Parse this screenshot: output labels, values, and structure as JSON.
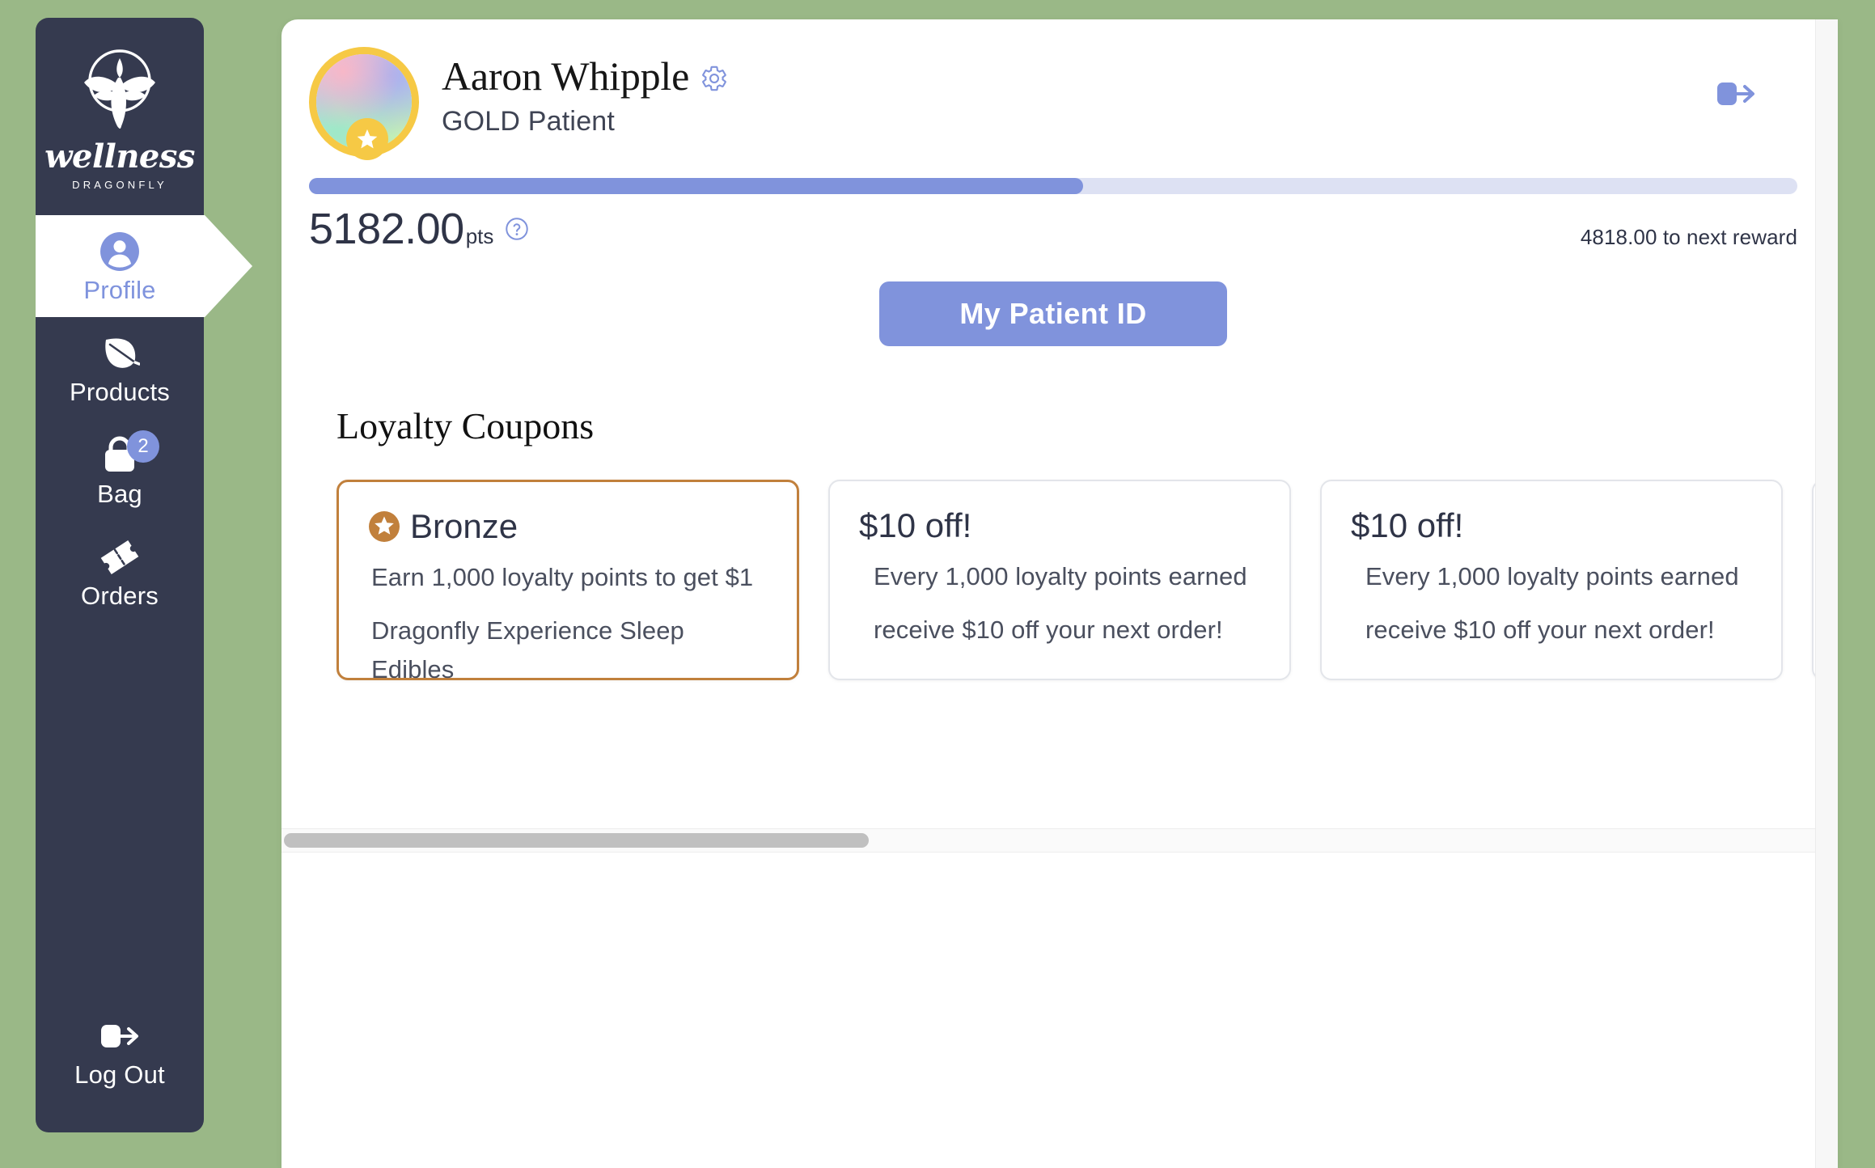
{
  "theme": {
    "background_green": "#9ab887",
    "sidebar_dark": "#353a4f",
    "accent_blue": "#8093dc",
    "gold": "#f6c945",
    "bronze": "#c1803c",
    "panel_white": "#ffffff"
  },
  "sidebar": {
    "brand": {
      "logo_icon": "dragonfly-lotus-icon",
      "name": "wellness",
      "subtitle": "DRAGONFLY"
    },
    "items": [
      {
        "id": "profile",
        "label": "Profile",
        "icon": "user-circle-icon",
        "active": true,
        "badge": null
      },
      {
        "id": "products",
        "label": "Products",
        "icon": "leaf-icon",
        "active": false,
        "badge": null
      },
      {
        "id": "bag",
        "label": "Bag",
        "icon": "shopping-bag-icon",
        "active": false,
        "badge": "2"
      },
      {
        "id": "orders",
        "label": "Orders",
        "icon": "ticket-icon",
        "active": false,
        "badge": null
      }
    ],
    "logout": {
      "label": "Log Out",
      "icon": "logout-icon"
    }
  },
  "header": {
    "avatar": {
      "icon": "gradient-avatar",
      "badge_icon": "star-icon"
    },
    "patient_name": "Aaron Whipple",
    "settings_icon": "gear-icon",
    "tier_label": "GOLD Patient",
    "logout_icon": "logout-icon"
  },
  "loyalty": {
    "progress_percent": 52,
    "points_value": "5182.00",
    "points_unit": "pts",
    "help_icon": "question-circle-icon",
    "next_reward_text": "4818.00 to next reward",
    "patient_id_button": "My Patient ID"
  },
  "coupons": {
    "section_title": "Loyalty Coupons",
    "cards": [
      {
        "title": "Bronze",
        "badge_icon": "bronze-star-icon",
        "highlighted": true,
        "line1": "Earn 1,000 loyalty points to get $1",
        "line2": "Dragonfly Experience Sleep Edibles"
      },
      {
        "title": "$10 off!",
        "badge_icon": null,
        "highlighted": false,
        "line1": "Every 1,000 loyalty points earned",
        "line2": "receive $10 off your next order!"
      },
      {
        "title": "$10 off!",
        "badge_icon": null,
        "highlighted": false,
        "line1": "Every 1,000 loyalty points earned",
        "line2": "receive $10 off your next order!"
      },
      {
        "title": "",
        "badge_icon": null,
        "highlighted": false,
        "line1": "",
        "line2": ""
      }
    ]
  }
}
